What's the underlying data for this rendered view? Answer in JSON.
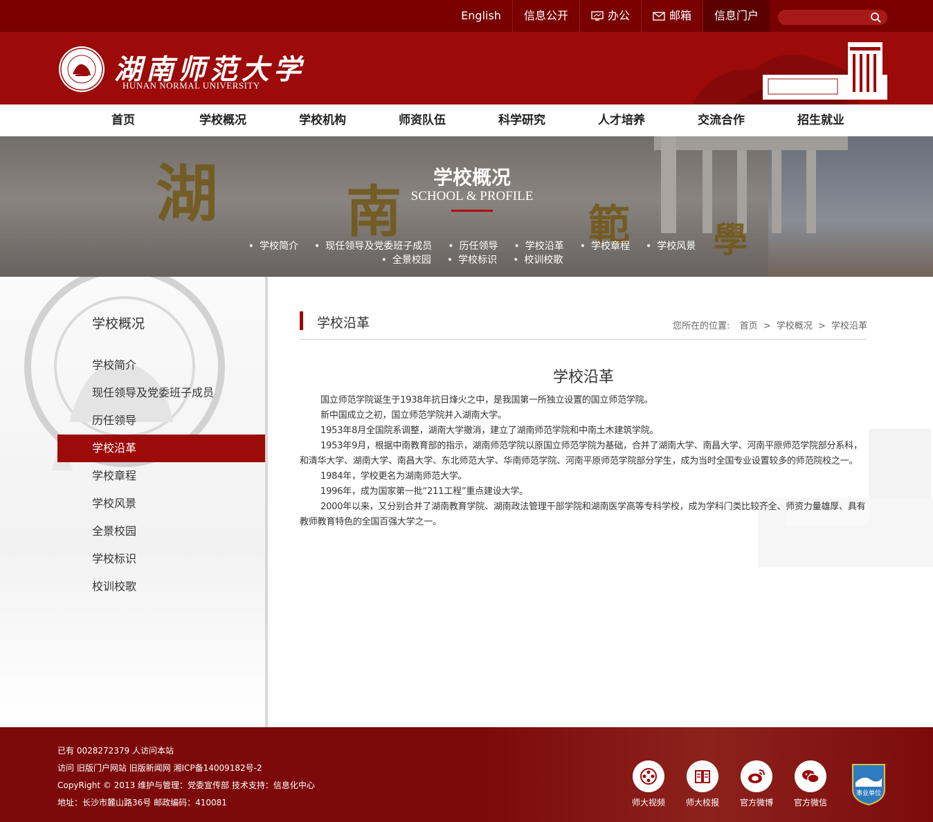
{
  "topbar": {
    "links": [
      "English",
      "信息公开",
      "办公",
      "邮箱",
      "信息门户"
    ],
    "search_placeholder": ""
  },
  "header": {
    "name_cn": "湖南师范大学",
    "name_en": "HUNAN NORMAL UNIVERSITY"
  },
  "nav": {
    "items": [
      "首页",
      "学校概况",
      "学校机构",
      "师资队伍",
      "科学研究",
      "人才培养",
      "交流合作",
      "招生就业"
    ]
  },
  "banner": {
    "title": "学校概况",
    "subtitle": "SCHOOL & PROFILE",
    "links_row1": [
      "学校简介",
      "现任领导及党委班子成员",
      "历任领导",
      "学校沿革",
      "学校章程",
      "学校风景"
    ],
    "links_row2": [
      "全景校园",
      "学校标识",
      "校训校歌"
    ]
  },
  "sidebar": {
    "title": "学校概况",
    "items": [
      "学校简介",
      "现任领导及党委班子成员",
      "历任领导",
      "学校沿革",
      "学校章程",
      "学校风景",
      "全景校园",
      "学校标识",
      "校训校歌"
    ],
    "active_index": 3
  },
  "content": {
    "section_title": "学校沿革",
    "breadcrumb": {
      "prefix": "您所在的位置:",
      "items": [
        "首页",
        "学校概况",
        "学校沿革"
      ],
      "separator": ">"
    },
    "article_title": "学校沿革",
    "paragraphs": [
      "国立师范学院诞生于1938年抗日烽火之中，是我国第一所独立设置的国立师范学院。",
      "新中国成立之初，国立师范学院并入湖南大学。",
      "1953年8月全国院系调整，湖南大学撤消，建立了湖南师范学院和中南土木建筑学院。",
      "1953年9月，根据中南教育部的指示，湖南师范学院以原国立师范学院为基础，合并了湖南大学、南昌大学、河南平原师范学院部分系科，和清华大学、湖南大学、南昌大学、东北师范大学、华南师范学院、河南平原师范学院部分学生，成为当时全国专业设置较多的师范院校之一。",
      "1984年，学校更名为湖南师范大学。",
      "1996年，成为国家第一批“211工程”重点建设大学。",
      "2000年以来，又分别合并了湖南教育学院、湖南政法管理干部学院和湖南医学高等专科学校，成为学科门类比较齐全、师资力量雄厚、具有教师教育特色的全国百强大学之一。"
    ]
  },
  "footer": {
    "visits": "已有 0028272379 人访问本站",
    "links_line": "访问 旧版门户网站 旧版新闻网 湘ICP备14009182号-2",
    "copyright": "CopyRight © 2013 维护与管理：党委宣传部 技术支持：信息化中心",
    "address": "地址：长沙市麓山路36号 邮政编码：410081",
    "icons": [
      {
        "label": "师大视频",
        "icon": "film-reel-icon"
      },
      {
        "label": "师大校报",
        "icon": "newspaper-icon"
      },
      {
        "label": "官方微博",
        "icon": "weibo-icon"
      },
      {
        "label": "官方微信",
        "icon": "wechat-icon"
      }
    ],
    "badge_text": "事业单位"
  },
  "colors": {
    "brand": "#9c0a0a",
    "topbar": "#7a0000",
    "footer": "#7d0a0a"
  }
}
